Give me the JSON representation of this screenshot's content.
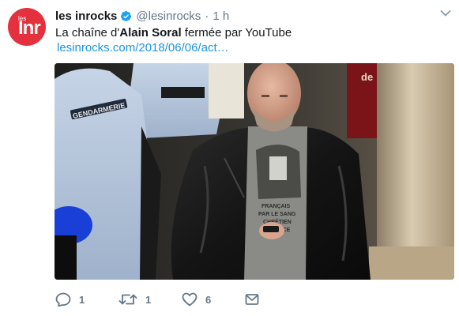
{
  "tweet": {
    "author_name": "les inrocks",
    "handle": "@lesinrocks",
    "separator": "·",
    "time": "1 h",
    "text_before": "La chaîne d'",
    "text_bold": "Alain Soral",
    "text_after": " fermée par YouTube",
    "link": "lesinrocks.com/2018/06/06/act…",
    "avatar": {
      "line1": "les",
      "line2": "Inr"
    },
    "photo_text": {
      "sign": "de",
      "patch": "GENDARMERIE",
      "shirt_line1": "FRANÇAIS",
      "shirt_line2": "PAR LE SANG",
      "shirt_line3": "CHRÉTIEN",
      "shirt_line4": "LA GRÂCE"
    }
  },
  "actions": {
    "reply_count": "1",
    "retweet_count": "1",
    "like_count": "6"
  },
  "icons": [
    "verified-icon",
    "chevron-down-icon",
    "reply-icon",
    "retweet-icon",
    "like-icon",
    "message-icon"
  ],
  "colors": {
    "link": "#1b95e0",
    "muted": "#657786",
    "verified": "#1da1f2",
    "avatar": "#e3323e"
  }
}
